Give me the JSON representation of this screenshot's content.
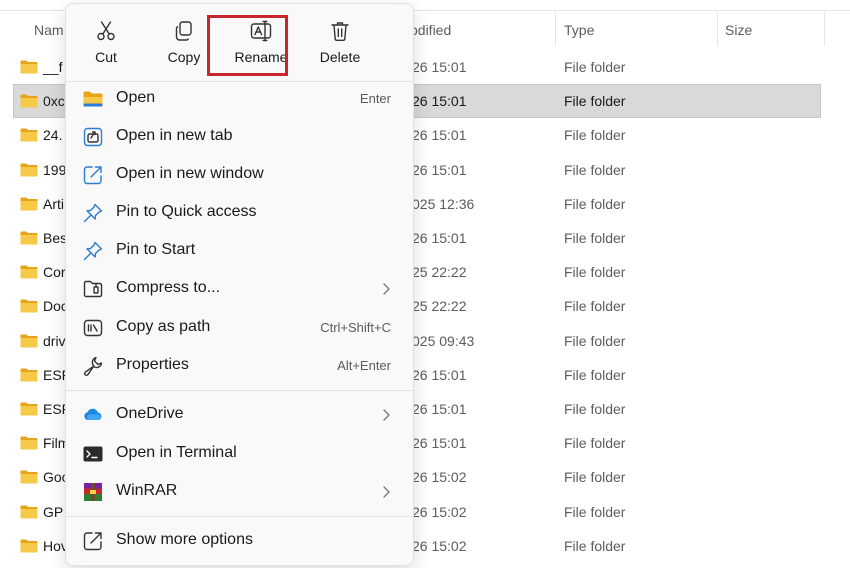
{
  "columns": {
    "name": "Nam",
    "date": "odified",
    "type": "Type",
    "size": "Size"
  },
  "rows": [
    {
      "name": "__f",
      "date": "26 15:01",
      "type": "File folder",
      "selected": false
    },
    {
      "name": "0xc",
      "date": "26 15:01",
      "type": "File folder",
      "selected": true
    },
    {
      "name": "24.",
      "date": "26 15:01",
      "type": "File folder",
      "selected": false
    },
    {
      "name": "199",
      "date": "26 15:01",
      "type": "File folder",
      "selected": false
    },
    {
      "name": "Arti",
      "date": "025 12:36",
      "type": "File folder",
      "selected": false
    },
    {
      "name": "Bes",
      "date": "26 15:01",
      "type": "File folder",
      "selected": false
    },
    {
      "name": "Cor",
      "date": "25 22:22",
      "type": "File folder",
      "selected": false
    },
    {
      "name": "Doc",
      "date": "25 22:22",
      "type": "File folder",
      "selected": false
    },
    {
      "name": "driv",
      "date": "025 09:43",
      "type": "File folder",
      "selected": false
    },
    {
      "name": "ESF",
      "date": "26 15:01",
      "type": "File folder",
      "selected": false
    },
    {
      "name": "ESF",
      "date": "26 15:01",
      "type": "File folder",
      "selected": false
    },
    {
      "name": "Film",
      "date": "26 15:01",
      "type": "File folder",
      "selected": false
    },
    {
      "name": "Goo",
      "date": "26 15:02",
      "type": "File folder",
      "selected": false
    },
    {
      "name": "GP",
      "date": "26 15:02",
      "type": "File folder",
      "selected": false
    },
    {
      "name": "Hov",
      "date": "26 15:02",
      "type": "File folder",
      "selected": false
    }
  ],
  "menu": {
    "quick_actions": [
      {
        "label": "Cut",
        "icon": "scissors-icon"
      },
      {
        "label": "Copy",
        "icon": "copy-icon"
      },
      {
        "label": "Rename",
        "icon": "rename-icon"
      },
      {
        "label": "Delete",
        "icon": "trash-icon"
      }
    ],
    "items": [
      {
        "label": "Open",
        "shortcut": "Enter",
        "icon": "folder-open-icon"
      },
      {
        "label": "Open in new tab",
        "shortcut": "",
        "icon": "new-tab-icon"
      },
      {
        "label": "Open in new window",
        "shortcut": "",
        "icon": "new-window-icon"
      },
      {
        "label": "Pin to Quick access",
        "shortcut": "",
        "icon": "pin-icon"
      },
      {
        "label": "Pin to Start",
        "shortcut": "",
        "icon": "pin-icon"
      },
      {
        "label": "Compress to...",
        "shortcut": "",
        "icon": "zip-icon",
        "submenu": true
      },
      {
        "label": "Copy as path",
        "shortcut": "Ctrl+Shift+C",
        "icon": "copy-path-icon"
      },
      {
        "label": "Properties",
        "shortcut": "Alt+Enter",
        "icon": "wrench-icon"
      },
      {
        "label": "OneDrive",
        "shortcut": "",
        "icon": "onedrive-cloud-icon",
        "submenu": true
      },
      {
        "label": "Open in Terminal",
        "shortcut": "",
        "icon": "terminal-icon"
      },
      {
        "label": "WinRAR",
        "shortcut": "",
        "icon": "winrar-icon",
        "submenu": true
      },
      {
        "label": "Show more options",
        "shortcut": "",
        "icon": "show-more-icon"
      }
    ]
  },
  "colors": {
    "highlight": "#c8262f",
    "folder": "#f5c542",
    "accent": "#2b7cd3"
  }
}
